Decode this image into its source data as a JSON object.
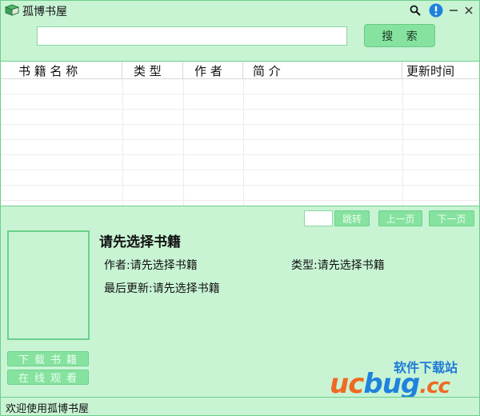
{
  "window": {
    "title": "孤博书屋"
  },
  "search": {
    "value": "",
    "placeholder": "",
    "button_label": "搜 索"
  },
  "table": {
    "columns": [
      "书 籍 名 称",
      "类 型",
      "作 者",
      "简 介",
      "更新时间"
    ],
    "rows": []
  },
  "pager": {
    "page_value": "",
    "jump_label": "跳转",
    "prev_label": "上一页",
    "next_label": "下一页"
  },
  "detail": {
    "title": "请先选择书籍",
    "author_label": "作者:",
    "author_value": "请先选择书籍",
    "type_label": "类型:",
    "type_value": "请先选择书籍",
    "updated_label": "最后更新:",
    "updated_value": "请先选择书籍",
    "download_label": "下载书籍",
    "read_online_label": "在线观看"
  },
  "status": {
    "text": "欢迎使用孤博书屋"
  },
  "watermark": {
    "site_name": "软件下载站",
    "logo_uc": "uc",
    "logo_bug": "bug",
    "logo_cc": ".cc"
  },
  "colors": {
    "background": "#c8f4d4",
    "border": "#6ccf8a",
    "button": "#86e29f",
    "info_icon": "#1f82dd"
  }
}
